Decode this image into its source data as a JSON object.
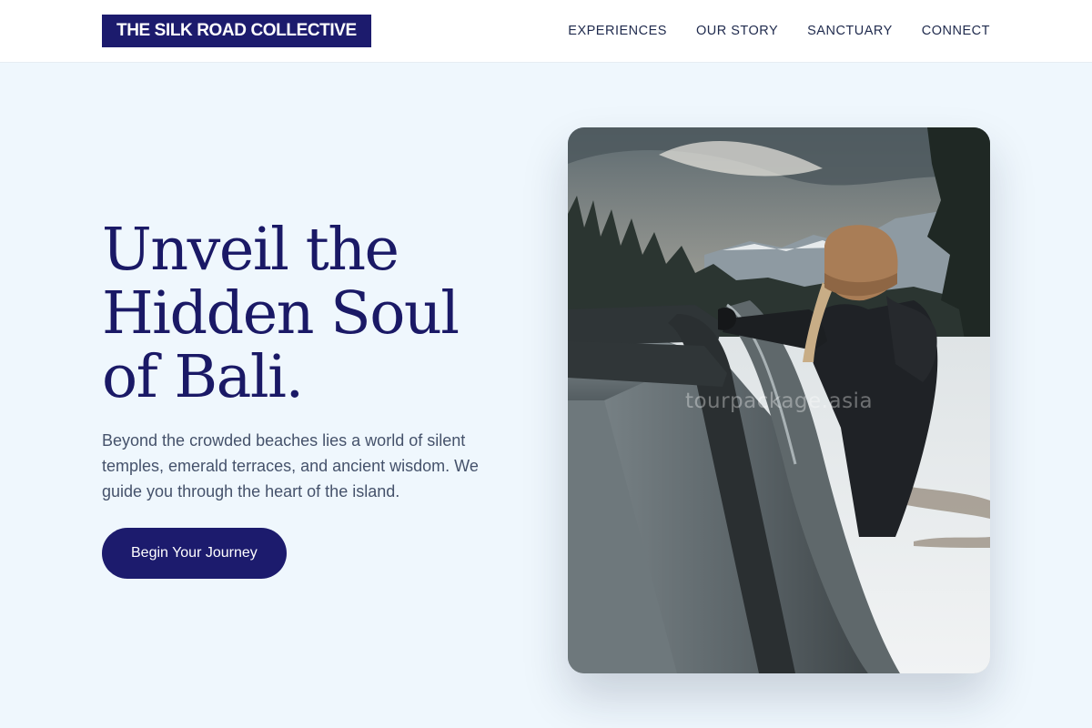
{
  "header": {
    "logo": "THE SILK ROAD COLLECTIVE",
    "nav": [
      {
        "label": "EXPERIENCES"
      },
      {
        "label": "OUR STORY"
      },
      {
        "label": "SANCTUARY"
      },
      {
        "label": "CONNECT"
      }
    ]
  },
  "hero": {
    "headline_lines": [
      "Unveil the",
      "Hidden Soul",
      "of Bali."
    ],
    "description": "Beyond the crowded beaches lies a world of silent temples, emerald terraces, and ancient wisdom. We guide you through the heart of the island.",
    "cta_label": "Begin Your Journey",
    "image": {
      "subject": "woman in tan beanie leaning out of a car in a snowy forest",
      "watermark": "tourpackage.asia"
    }
  },
  "colors": {
    "brand": "#1c1b6d",
    "background": "#eff7fd",
    "body_text": "#45526b"
  }
}
